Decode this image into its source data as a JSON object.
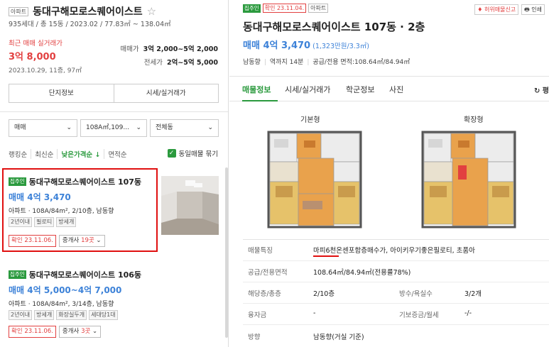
{
  "left": {
    "complex_tag": "아파트",
    "complex_name": "동대구해모로스퀘어이스트",
    "summary": "935세대 / 총 15동 / 2023.02 / 77.83㎡ ~ 138.04㎡",
    "recent": {
      "label": "최근 매매 실거래가",
      "price": "3억 8,000",
      "date": "2023.10.29, 11층, 97㎡"
    },
    "price_ranges": [
      {
        "label": "매매가",
        "value": "3억 2,000~5억 2,000"
      },
      {
        "label": "전세가",
        "value": "2억~5억 5,000"
      }
    ],
    "buttons": [
      "단지정보",
      "시세/실거래가"
    ],
    "filters": [
      "매매",
      "108A㎡,109...",
      "전체동"
    ],
    "sorts": [
      "랭킹순",
      "최신순",
      "낮은가격순 ↓",
      "면적순"
    ],
    "same_listing_label": "동일매물 묶기",
    "listings": [
      {
        "badge": "집주인",
        "name": "동대구해모로스퀘어이스트 107동",
        "price": "매매 4억 3,470",
        "desc": "아파트 · 108A/84m², 2/10층, 남동향",
        "tags": [
          "2년이내",
          "필로티",
          "방세개"
        ],
        "confirm": "확인 23.11.06.",
        "agent_prefix": "중개사 ",
        "agent_count": "19곳",
        "agent_suffix": " ⌄"
      },
      {
        "badge": "집주인",
        "name": "동대구해모로스퀘어이스트 106동",
        "price": "매매 4억 5,000~4억 7,000",
        "desc": "아파트 · 108A/84m², 3/14층, 남동향",
        "tags": [
          "2년이내",
          "방세개",
          "화장실두개",
          "세대당1대"
        ],
        "confirm": "확인 23.11.06.",
        "agent_prefix": "중개사 ",
        "agent_count": "3곳",
        "agent_suffix": " ⌄"
      }
    ]
  },
  "right": {
    "badge": "집주인",
    "confirm": "확인 23.11.04.",
    "type_tag": "아파트",
    "report_btn": "♦ 허위매물신고",
    "print_btn": "🖶 인쇄",
    "title": "동대구해모로스퀘어이스트 107동 · 2층",
    "price": "매매 4억 3,470",
    "price_unit": "(1,323만원/3.3㎡)",
    "meta": [
      "남동향",
      "역까지 14분",
      "공급/전용 면적:108.64㎡/84.94㎡"
    ],
    "tabs": [
      "매물정보",
      "시세/실거래가",
      "학군정보",
      "사진"
    ],
    "refresh": "↻ 평",
    "floorplans": [
      "기본형",
      "확장형"
    ],
    "info": [
      {
        "k": "매물특징",
        "v": "마피6천온센포함층매수가, 아이키우기좋은필로티, 초품아"
      },
      {
        "k": "공급/전용면적",
        "v": "108.64㎡/84.94㎡(전용률78%)"
      },
      {
        "k": "해당층/총층",
        "v": "2/10층",
        "k2": "방수/욕실수",
        "v2": "3/2개"
      },
      {
        "k": "융자금",
        "v": "-",
        "k2": "기보증금/월세",
        "v2": "-/-"
      },
      {
        "k": "방향",
        "v": "남동향(거실 기준)"
      }
    ]
  }
}
